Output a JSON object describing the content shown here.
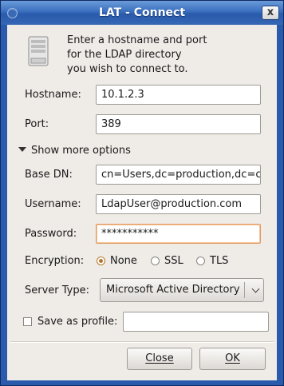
{
  "window": {
    "title": "LAT - Connect",
    "close_glyph": "x"
  },
  "intro": {
    "lines": [
      "Enter a hostname and port",
      "for the LDAP directory",
      "you wish to connect to."
    ]
  },
  "form": {
    "hostname_label": "Hostname:",
    "hostname_value": "10.1.2.3",
    "port_label": "Port:",
    "port_value": "389",
    "more_options_label": "Show more options",
    "base_dn_label": "Base DN:",
    "base_dn_value": "cn=Users,dc=production,dc=c",
    "username_label": "Username:",
    "username_value": "LdapUser@production.com",
    "password_label": "Password:",
    "password_value": "***********",
    "encryption_label": "Encryption:",
    "encryption_options": [
      "None",
      "SSL",
      "TLS"
    ],
    "encryption_selected": "None",
    "server_type_label": "Server Type:",
    "server_type_value": "Microsoft Active Directory",
    "save_profile_label": "Save as profile:",
    "save_profile_checked": false,
    "save_profile_value": ""
  },
  "buttons": {
    "close": "Close",
    "ok": "OK"
  },
  "colors": {
    "titlebar": "#3a6fbe",
    "focus": "#e29b61",
    "radio_accent": "#b5772f"
  },
  "icons": [
    "server-icon",
    "close-icon",
    "disclosure-triangle-icon",
    "chevron-down-icon"
  ]
}
